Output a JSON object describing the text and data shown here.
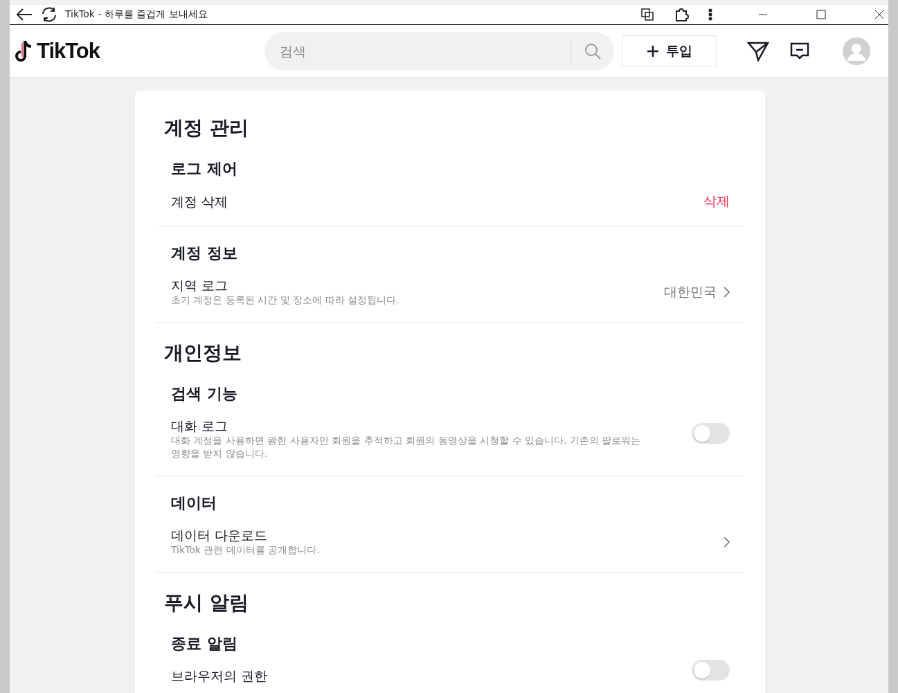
{
  "titlebar": {
    "title": "TikTok - 하루를 즐겁게 보내세요"
  },
  "header": {
    "logo": "TikTok",
    "search": {
      "placeholder": "검색"
    },
    "upload": {
      "label": "투입"
    }
  },
  "sections": [
    {
      "title": "계정 관리",
      "groups": [
        {
          "title": "로그 제어",
          "rows": [
            {
              "kind": "action",
              "label": "계정 삭제",
              "action": "삭제"
            }
          ]
        },
        {
          "title": "계정 정보",
          "rows": [
            {
              "kind": "link",
              "label": "지역 로그",
              "description": "초기 계정은 등록된 시간 및 장소에 따라 설정됩니다.",
              "value": "대한민국"
            }
          ]
        }
      ]
    },
    {
      "title": "개인정보",
      "groups": [
        {
          "title": "검색 기능",
          "rows": [
            {
              "kind": "toggle",
              "label": "대화 로그",
              "description": "대화 계정을 사용하면 왕한 사용자만 회원을 추적하고 회원의 동영상을 시청할 수 있습니다. 기존의 팔로워는 영향을 받지 않습니다.",
              "on": false
            }
          ]
        },
        {
          "title": "데이터",
          "rows": [
            {
              "kind": "link",
              "label": "데이터 다운로드",
              "description": "TikTok 관련 데이터를 공개합니다."
            }
          ]
        }
      ]
    },
    {
      "title": "푸시 알림",
      "groups": [
        {
          "title": "종료 알림",
          "rows": [
            {
              "kind": "toggle",
              "label": "브라우저의 권한",
              "on": false
            }
          ]
        }
      ]
    }
  ]
}
